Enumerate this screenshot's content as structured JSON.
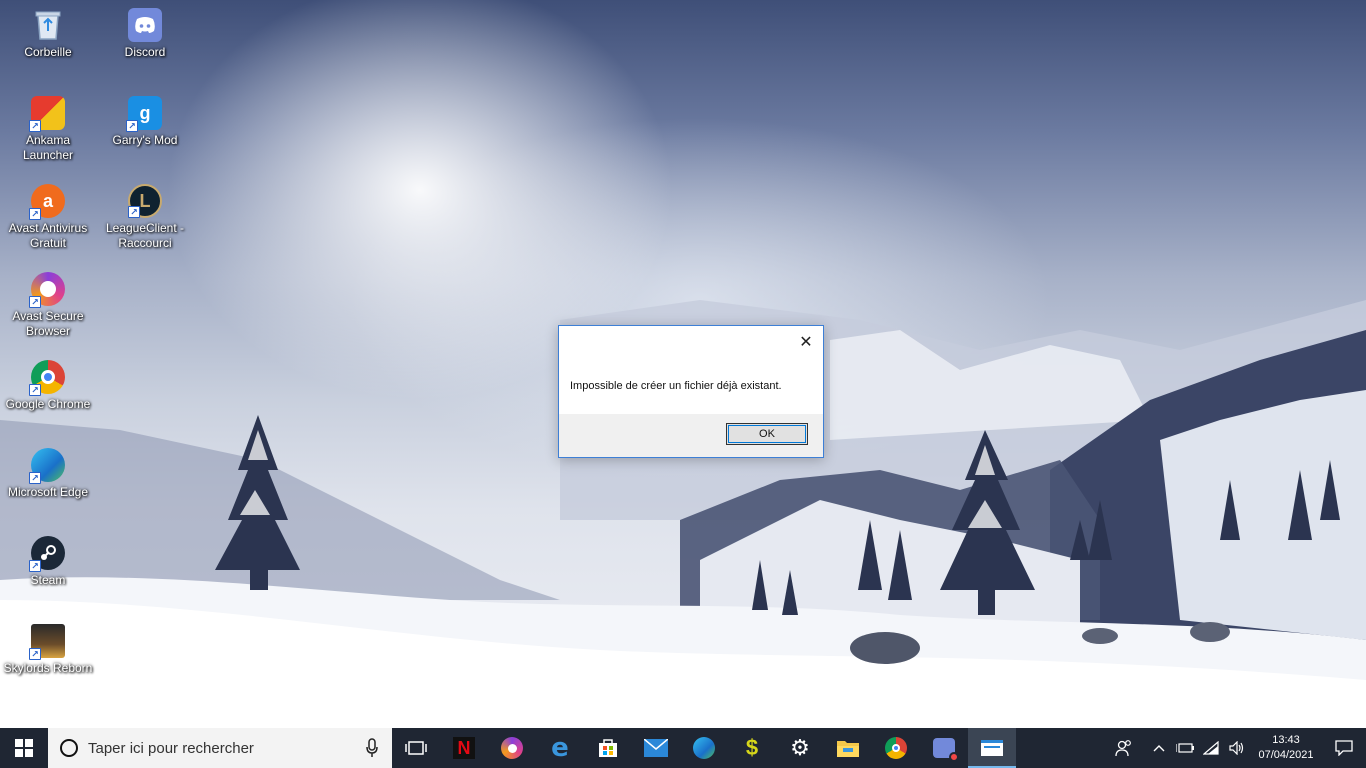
{
  "desktop": {
    "icons": [
      {
        "label": "Corbeille",
        "icon": "recycle-bin-icon"
      },
      {
        "label": "Discord",
        "icon": "discord-icon"
      },
      {
        "label": "Ankama Launcher",
        "icon": "ankama-icon"
      },
      {
        "label": "Garry's Mod",
        "icon": "garrys-mod-icon"
      },
      {
        "label": "Avast Antivirus Gratuit",
        "icon": "avast-icon"
      },
      {
        "label": "LeagueClient - Raccourci",
        "icon": "league-icon"
      },
      {
        "label": "Avast Secure Browser",
        "icon": "avast-browser-icon"
      },
      {
        "label": "Google Chrome",
        "icon": "chrome-icon"
      },
      {
        "label": "Microsoft Edge",
        "icon": "edge-icon"
      },
      {
        "label": "Steam",
        "icon": "steam-icon"
      },
      {
        "label": "Skylords Reborn",
        "icon": "skylords-icon"
      }
    ]
  },
  "dialog": {
    "message": "Impossible de créer un fichier déjà existant.",
    "ok_label": "OK",
    "close_glyph": "✕"
  },
  "taskbar": {
    "search_placeholder": "Taper ici pour rechercher",
    "apps": [
      "task-view-icon",
      "netflix-icon",
      "avast-browser-icon",
      "edge-legacy-icon",
      "store-icon",
      "mail-icon",
      "edge-icon",
      "dollar-icon",
      "settings-icon",
      "file-explorer-icon",
      "chrome-icon",
      "discord-app-icon",
      "active-window-icon"
    ],
    "time": "13:43",
    "date": "07/04/2021"
  },
  "colors": {
    "taskbar": "#1f2633",
    "accent": "#0078d7",
    "dialog_border": "#3d7fd6"
  }
}
